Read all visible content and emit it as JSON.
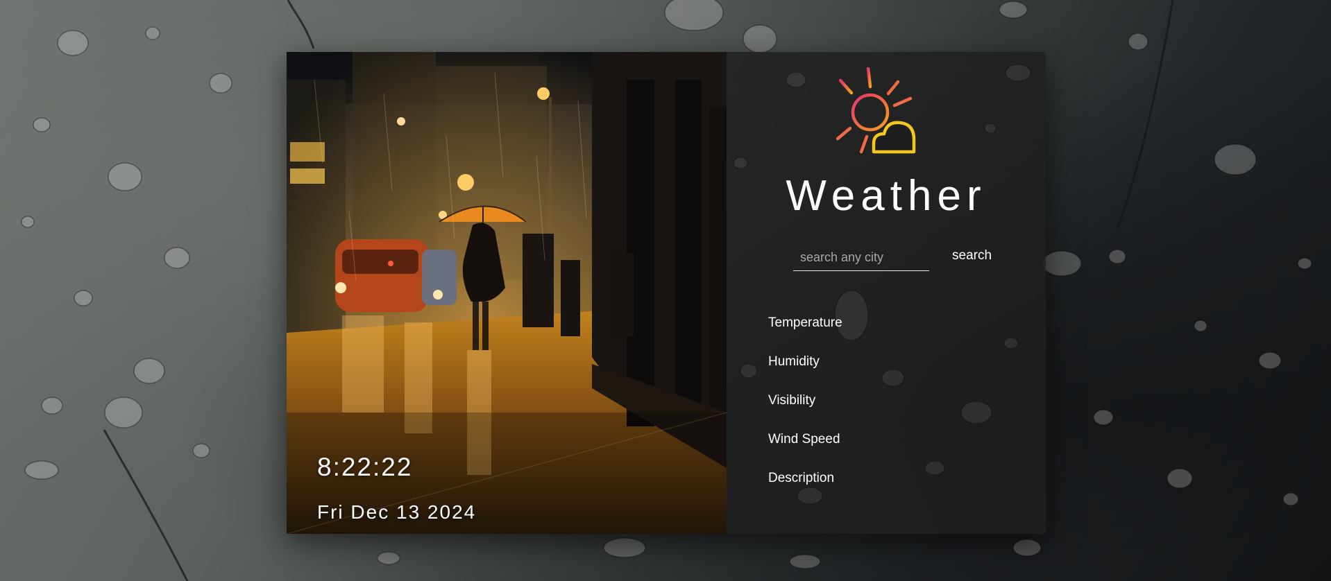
{
  "clock": {
    "time": "8:22:22",
    "date": "Fri Dec 13 2024"
  },
  "weather": {
    "title": "Weather",
    "logo_icon": "sun-cloud-icon",
    "search": {
      "placeholder": "search any city",
      "value": "",
      "button_label": "search"
    },
    "details": [
      {
        "label": "Temperature"
      },
      {
        "label": "Humidity"
      },
      {
        "label": "Visibility"
      },
      {
        "label": "Wind Speed"
      },
      {
        "label": "Description"
      }
    ]
  },
  "colors": {
    "sun_stroke_start": "#e8336d",
    "sun_stroke_end": "#f6a31c",
    "cloud_stroke": "#f7c51c",
    "text": "#ffffff"
  }
}
